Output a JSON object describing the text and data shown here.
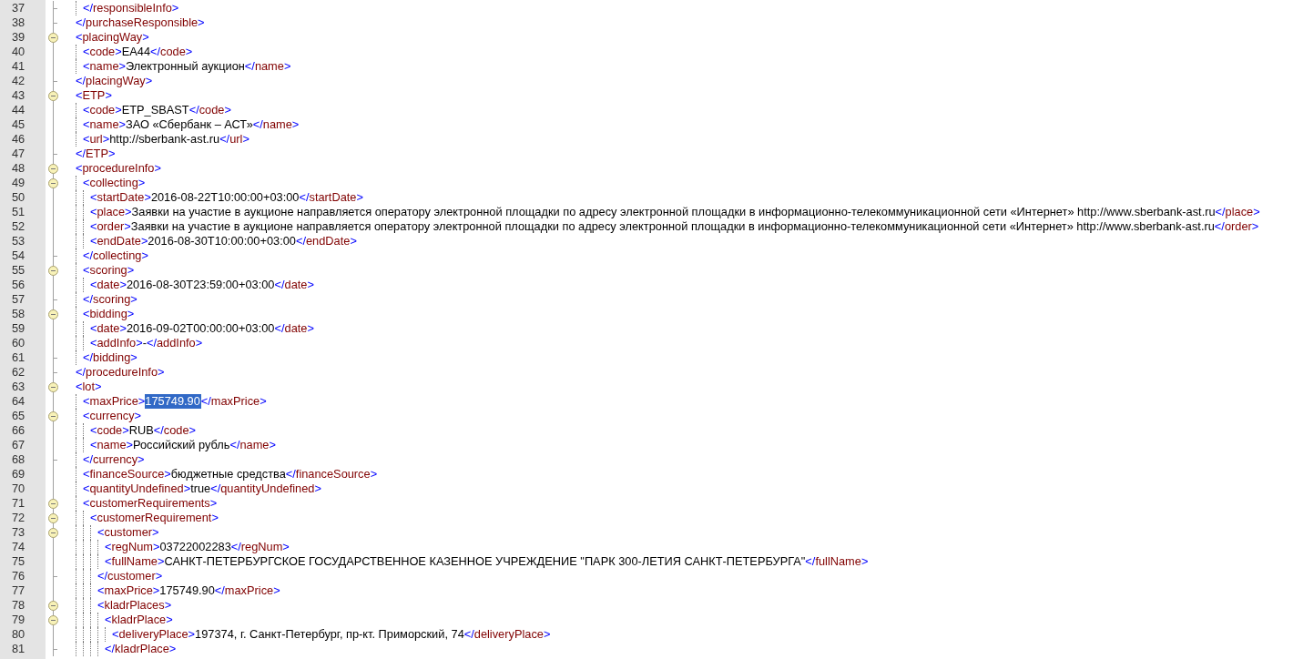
{
  "editor": {
    "lines": [
      {
        "children": [
          {
            "number": "37",
            "kind": "fold-end",
            "segments": [
              {
                "text": "</responsibleInfo>",
                "selected": false
              }
            ]
          }
        ]
      },
      {
        "number": "38",
        "kind": "fold-end",
        "segments": [
          {
            "text": "</purchaseResponsible>",
            "selected": false
          }
        ]
      },
      {
        "number": "39",
        "kind": "fold-start",
        "segments": [
          {
            "text": "<placingWay>",
            "selected": false
          }
        ],
        "children": [
          {
            "number": "40",
            "kind": "body",
            "segments": [
              {
                "text": "<code>EA44</code>",
                "selected": false
              }
            ]
          },
          {
            "number": "41",
            "kind": "body",
            "segments": [
              {
                "text": "<name>Электронный аукцион</name>",
                "selected": false
              }
            ]
          }
        ]
      },
      {
        "number": "42",
        "kind": "fold-end",
        "segments": [
          {
            "text": "</placingWay>",
            "selected": false
          }
        ]
      },
      {
        "number": "43",
        "kind": "fold-start",
        "segments": [
          {
            "text": "<ETP>",
            "selected": false
          }
        ],
        "children": [
          {
            "number": "44",
            "kind": "body",
            "segments": [
              {
                "text": "<code>ETP_SBAST</code>",
                "selected": false
              }
            ]
          },
          {
            "number": "45",
            "kind": "body",
            "segments": [
              {
                "text": "<name>ЗАО «Сбербанк – АСТ»</name>",
                "selected": false
              }
            ]
          },
          {
            "number": "46",
            "kind": "body",
            "segments": [
              {
                "text": "<url>http://sberbank-ast.ru</url>",
                "selected": false
              }
            ]
          }
        ]
      },
      {
        "number": "47",
        "kind": "fold-end",
        "segments": [
          {
            "text": "</ETP>",
            "selected": false
          }
        ]
      },
      {
        "number": "48",
        "kind": "fold-start",
        "segments": [
          {
            "text": "<procedureInfo>",
            "selected": false
          }
        ],
        "children": [
          {
            "number": "49",
            "kind": "fold-start",
            "segments": [
              {
                "text": "<collecting>",
                "selected": false
              }
            ],
            "children": [
              {
                "number": "50",
                "kind": "body",
                "segments": [
                  {
                    "text": "<startDate>2016-08-22T10:00:00+03:00</startDate>",
                    "selected": false
                  }
                ]
              },
              {
                "number": "51",
                "kind": "body",
                "segments": [
                  {
                    "text": "<place>Заявки на участие в аукционе направляется оператору электронной площадки по адресу электронной площадки в информационно-телекоммуникационной сети «Интернет» http://www.sberbank-ast.ru</place>",
                    "selected": false
                  }
                ]
              },
              {
                "number": "52",
                "kind": "body",
                "segments": [
                  {
                    "text": "<order>Заявки на участие в аукционе направляется оператору электронной площадки по адресу электронной площадки в информационно-телекоммуникационной сети «Интернет» http://www.sberbank-ast.ru</order>",
                    "selected": false
                  }
                ]
              },
              {
                "number": "53",
                "kind": "body",
                "segments": [
                  {
                    "text": "<endDate>2016-08-30T10:00:00+03:00</endDate>",
                    "selected": false
                  }
                ]
              }
            ]
          },
          {
            "number": "54",
            "kind": "fold-end",
            "segments": [
              {
                "text": "</collecting>",
                "selected": false
              }
            ]
          },
          {
            "number": "55",
            "kind": "fold-start",
            "segments": [
              {
                "text": "<scoring>",
                "selected": false
              }
            ],
            "children": [
              {
                "number": "56",
                "kind": "body",
                "segments": [
                  {
                    "text": "<date>2016-08-30T23:59:00+03:00</date>",
                    "selected": false
                  }
                ]
              }
            ]
          },
          {
            "number": "57",
            "kind": "fold-end",
            "segments": [
              {
                "text": "</scoring>",
                "selected": false
              }
            ]
          },
          {
            "number": "58",
            "kind": "fold-start",
            "segments": [
              {
                "text": "<bidding>",
                "selected": false
              }
            ],
            "children": [
              {
                "number": "59",
                "kind": "body",
                "segments": [
                  {
                    "text": "<date>2016-09-02T00:00:00+03:00</date>",
                    "selected": false
                  }
                ]
              },
              {
                "number": "60",
                "kind": "body",
                "segments": [
                  {
                    "text": "<addInfo>-</addInfo>",
                    "selected": false
                  }
                ]
              }
            ]
          },
          {
            "number": "61",
            "kind": "fold-end",
            "segments": [
              {
                "text": "</bidding>",
                "selected": false
              }
            ]
          }
        ]
      },
      {
        "number": "62",
        "kind": "fold-end",
        "segments": [
          {
            "text": "</procedureInfo>",
            "selected": false
          }
        ]
      },
      {
        "number": "63",
        "kind": "fold-start",
        "segments": [
          {
            "text": "<lot>",
            "selected": false
          }
        ],
        "children": [
          {
            "number": "64",
            "kind": "body",
            "segments": [
              {
                "text": "<maxPrice>",
                "selected": false
              },
              {
                "text": "175749.90",
                "selected": true
              },
              {
                "text": "</maxPrice>",
                "selected": false
              }
            ]
          },
          {
            "number": "65",
            "kind": "fold-start",
            "segments": [
              {
                "text": "<currency>",
                "selected": false
              }
            ],
            "children": [
              {
                "number": "66",
                "kind": "body",
                "segments": [
                  {
                    "text": "<code>RUB</code>",
                    "selected": false
                  }
                ]
              },
              {
                "number": "67",
                "kind": "body",
                "segments": [
                  {
                    "text": "<name>Российский рубль</name>",
                    "selected": false
                  }
                ]
              }
            ]
          },
          {
            "number": "68",
            "kind": "fold-end",
            "segments": [
              {
                "text": "</currency>",
                "selected": false
              }
            ]
          },
          {
            "number": "69",
            "kind": "body",
            "segments": [
              {
                "text": "<financeSource>бюджетные средства</financeSource>",
                "selected": false
              }
            ]
          },
          {
            "number": "70",
            "kind": "body",
            "segments": [
              {
                "text": "<quantityUndefined>true</quantityUndefined>",
                "selected": false
              }
            ]
          },
          {
            "number": "71",
            "kind": "fold-start",
            "segments": [
              {
                "text": "<customerRequirements>",
                "selected": false
              }
            ],
            "children": [
              {
                "number": "72",
                "kind": "fold-start",
                "segments": [
                  {
                    "text": "<customerRequirement>",
                    "selected": false
                  }
                ],
                "children": [
                  {
                    "number": "73",
                    "kind": "fold-start",
                    "segments": [
                      {
                        "text": "<customer>",
                        "selected": false
                      }
                    ],
                    "children": [
                      {
                        "number": "74",
                        "kind": "body",
                        "segments": [
                          {
                            "text": "<regNum>03722002283</regNum>",
                            "selected": false
                          }
                        ]
                      },
                      {
                        "number": "75",
                        "kind": "body",
                        "segments": [
                          {
                            "text": "<fullName>САНКТ-ПЕТЕРБУРГСКОЕ ГОСУДАРСТВЕННОЕ КАЗЕННОЕ УЧРЕЖДЕНИЕ \"ПАРК 300-ЛЕТИЯ САНКТ-ПЕТЕРБУРГА\"</fullName>",
                            "selected": false
                          }
                        ]
                      }
                    ]
                  },
                  {
                    "number": "76",
                    "kind": "fold-end",
                    "segments": [
                      {
                        "text": "</customer>",
                        "selected": false
                      }
                    ]
                  },
                  {
                    "number": "77",
                    "kind": "body",
                    "segments": [
                      {
                        "text": "<maxPrice>175749.90</maxPrice>",
                        "selected": false
                      }
                    ]
                  },
                  {
                    "number": "78",
                    "kind": "fold-start",
                    "segments": [
                      {
                        "text": "<kladrPlaces>",
                        "selected": false
                      }
                    ],
                    "children": [
                      {
                        "number": "79",
                        "kind": "fold-start",
                        "segments": [
                          {
                            "text": "<kladrPlace>",
                            "selected": false
                          }
                        ],
                        "children": [
                          {
                            "number": "80",
                            "kind": "body",
                            "segments": [
                              {
                                "text": "<deliveryPlace>197374, г. Санкт-Петербург, пр-кт. Приморский, 74</deliveryPlace>",
                                "selected": false
                              }
                            ]
                          }
                        ]
                      },
                      {
                        "number": "81",
                        "kind": "fold-end",
                        "segments": [
                          {
                            "text": "</kladrPlace>",
                            "selected": false
                          }
                        ]
                      }
                    ]
                  }
                ]
              }
            ]
          }
        ]
      }
    ]
  }
}
